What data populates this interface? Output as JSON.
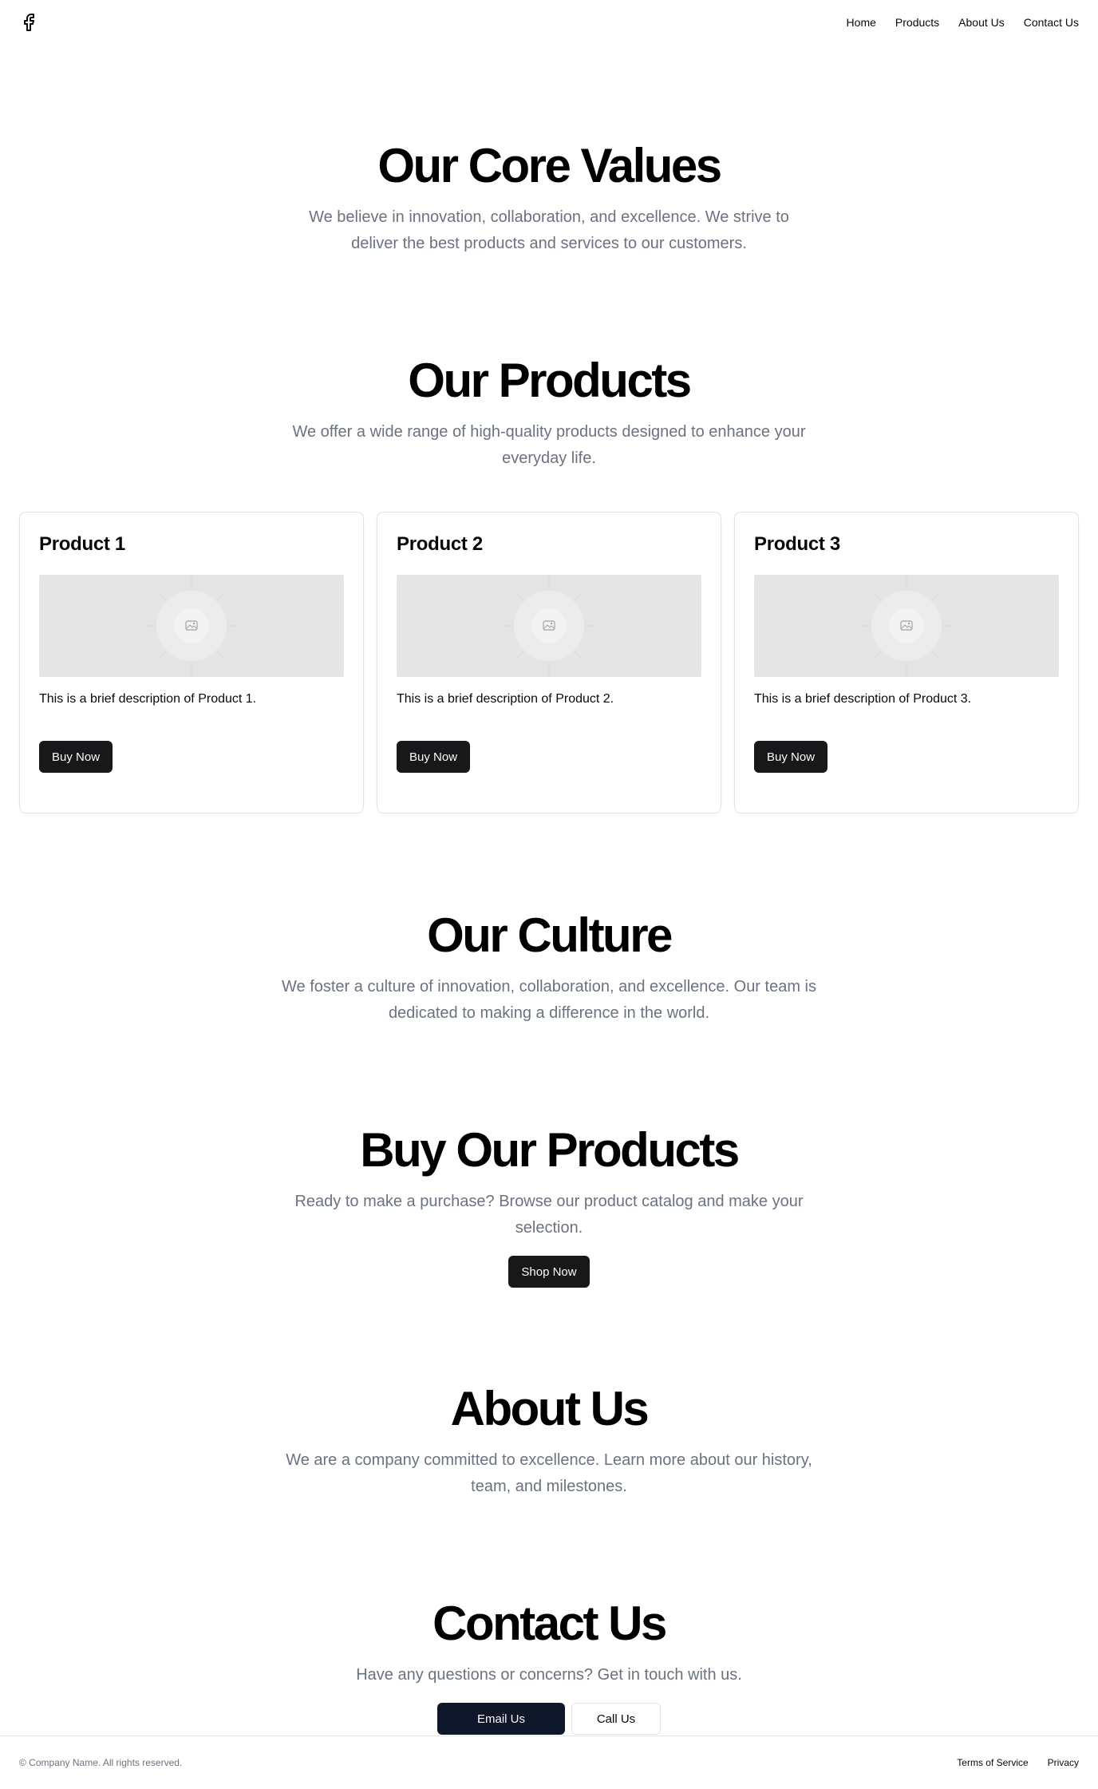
{
  "nav": {
    "logo_icon": "facebook-icon",
    "items": [
      "Home",
      "Products",
      "About Us",
      "Contact Us"
    ]
  },
  "values": {
    "title": "Our Core Values",
    "text": "We believe in innovation, collaboration, and excellence. We strive to deliver the best products and services to our customers."
  },
  "products": {
    "title": "Our Products",
    "text": "We offer a wide range of high-quality products designed to enhance your everyday life.",
    "items": [
      {
        "name": "Product 1",
        "description": "This is a brief description of Product 1.",
        "button": "Buy Now",
        "image_icon": "image-placeholder-icon"
      },
      {
        "name": "Product 2",
        "description": "This is a brief description of Product 2.",
        "button": "Buy Now",
        "image_icon": "image-placeholder-icon"
      },
      {
        "name": "Product 3",
        "description": "This is a brief description of Product 3.",
        "button": "Buy Now",
        "image_icon": "image-placeholder-icon"
      }
    ]
  },
  "culture": {
    "title": "Our Culture",
    "text": "We foster a culture of innovation, collaboration, and excellence. Our team is dedicated to making a difference in the world."
  },
  "buy": {
    "title": "Buy Our Products",
    "text": "Ready to make a purchase? Browse our product catalog and make your selection.",
    "button": "Shop Now"
  },
  "about": {
    "title": "About Us",
    "text": "We are a company committed to excellence. Learn more about our history, team, and milestones."
  },
  "contact": {
    "title": "Contact Us",
    "text": "Have any questions or concerns? Get in touch with us.",
    "email_button": "Email Us",
    "call_button": "Call Us"
  },
  "footer": {
    "copyright": "© Company Name. All rights reserved.",
    "links": [
      "Terms of Service",
      "Privacy"
    ]
  },
  "colors": {
    "primary_button": "#18181b",
    "email_button": "#0f172a",
    "muted_text": "#6b7280",
    "border": "#e4e4e7",
    "image_placeholder": "#e5e5e5"
  }
}
